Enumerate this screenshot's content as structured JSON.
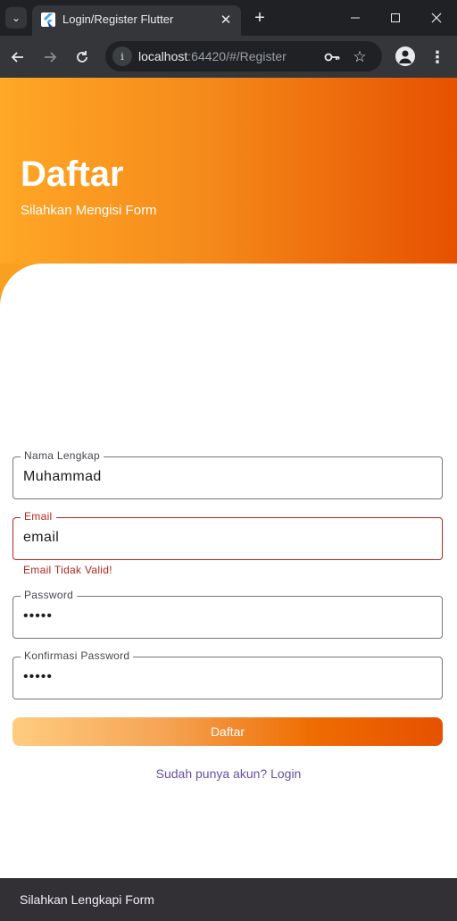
{
  "browser": {
    "tab_title": "Login/Register Flutter",
    "tab_close": "✕",
    "new_tab": "+",
    "url_host": "localhost",
    "url_rest": ":64420/#/Register",
    "site_info_icon": "i"
  },
  "header": {
    "title": "Daftar",
    "subtitle": "Silahkan Mengisi Form"
  },
  "form": {
    "name": {
      "label": "Nama Lengkap",
      "value": "Muhammad"
    },
    "email": {
      "label": "Email",
      "value": "email",
      "error": "Email Tidak Valid!"
    },
    "password": {
      "label": "Password",
      "value": "•••••"
    },
    "confirm_password": {
      "label": "Konfirmasi Password",
      "value": "•••••"
    },
    "submit_label": "Daftar",
    "login_link": "Sudah punya akun? Login"
  },
  "snackbar": {
    "message": "Silahkan Lengkapi Form"
  },
  "colors": {
    "header_gradient_start": "#ffa726",
    "header_gradient_end": "#e65100",
    "error": "#b3261e",
    "link": "#6750a4",
    "snackbar_bg": "#322f35"
  }
}
